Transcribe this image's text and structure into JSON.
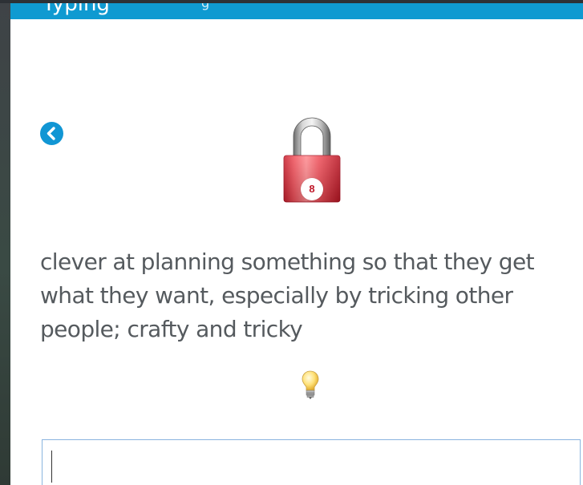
{
  "header": {
    "title": "Typing",
    "subtitle": "g"
  },
  "navigation": {
    "back_icon": "chevron-left-icon"
  },
  "lock": {
    "icon": "padlock-icon",
    "number": "8",
    "color": "#e8323f"
  },
  "definition": {
    "text": "clever at planning something so that they get what they want, especially by tricking other people; crafty and tricky"
  },
  "hint": {
    "icon": "lightbulb-icon"
  },
  "answer": {
    "value": "",
    "placeholder": ""
  },
  "colors": {
    "accent": "#0f9ad1",
    "text": "#555a5e",
    "input_border": "#8ab4df"
  }
}
